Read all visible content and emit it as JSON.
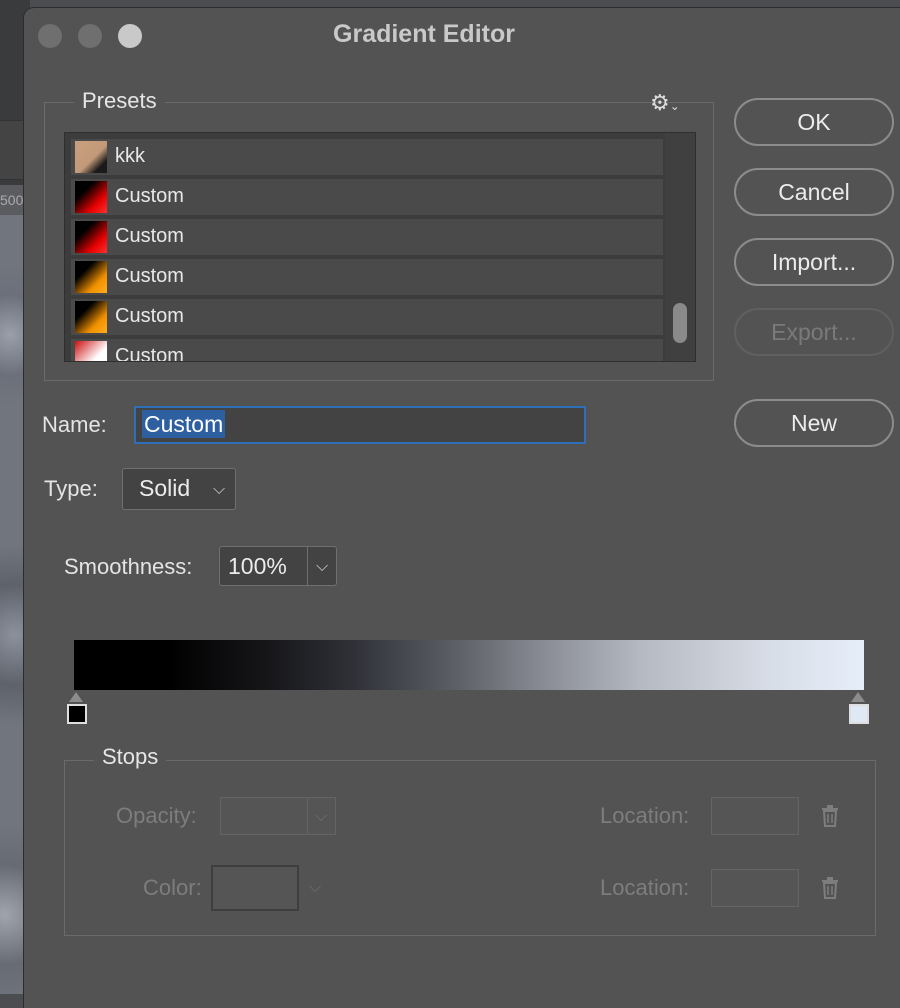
{
  "background": {
    "ruler_text": "500"
  },
  "dialog": {
    "title": "Gradient Editor",
    "presets": {
      "legend": "Presets",
      "items": [
        {
          "label": "kkk",
          "swatch": "linear-gradient(135deg,#c9a07f 0%,#c29a79 55%,#1a1a1a 80%)"
        },
        {
          "label": "Custom",
          "swatch": "linear-gradient(135deg,#000 30%,#e60000 70%,#ff3030 100%)"
        },
        {
          "label": "Custom",
          "swatch": "linear-gradient(135deg,#000 30%,#e60000 70%,#ff3030 100%)"
        },
        {
          "label": "Custom",
          "swatch": "linear-gradient(135deg,#000 30%,#f09000 70%,#ffae20 100%)"
        },
        {
          "label": "Custom",
          "swatch": "linear-gradient(135deg,#000 30%,#f09000 70%,#ffae20 100%)"
        },
        {
          "label": "Custom",
          "swatch": "linear-gradient(135deg,#cc1010 0%,#ffffff 60%,#ffffff 100%)"
        }
      ]
    },
    "buttons": {
      "ok": "OK",
      "cancel": "Cancel",
      "import": "Import...",
      "export": "Export...",
      "new": "New"
    },
    "name": {
      "label": "Name:",
      "value": "Custom"
    },
    "type": {
      "label": "Type:",
      "value": "Solid"
    },
    "smoothness": {
      "label": "Smoothness:",
      "value": "100%"
    },
    "stops": {
      "legend": "Stops",
      "opacity_label": "Opacity:",
      "color_label": "Color:",
      "location_label_1": "Location:",
      "location_label_2": "Location:"
    },
    "colors": {
      "accent": "#2e5fa0",
      "focus_border": "#2f6fb7",
      "left_stop": "#000000",
      "right_stop": "#e6eefa"
    }
  }
}
